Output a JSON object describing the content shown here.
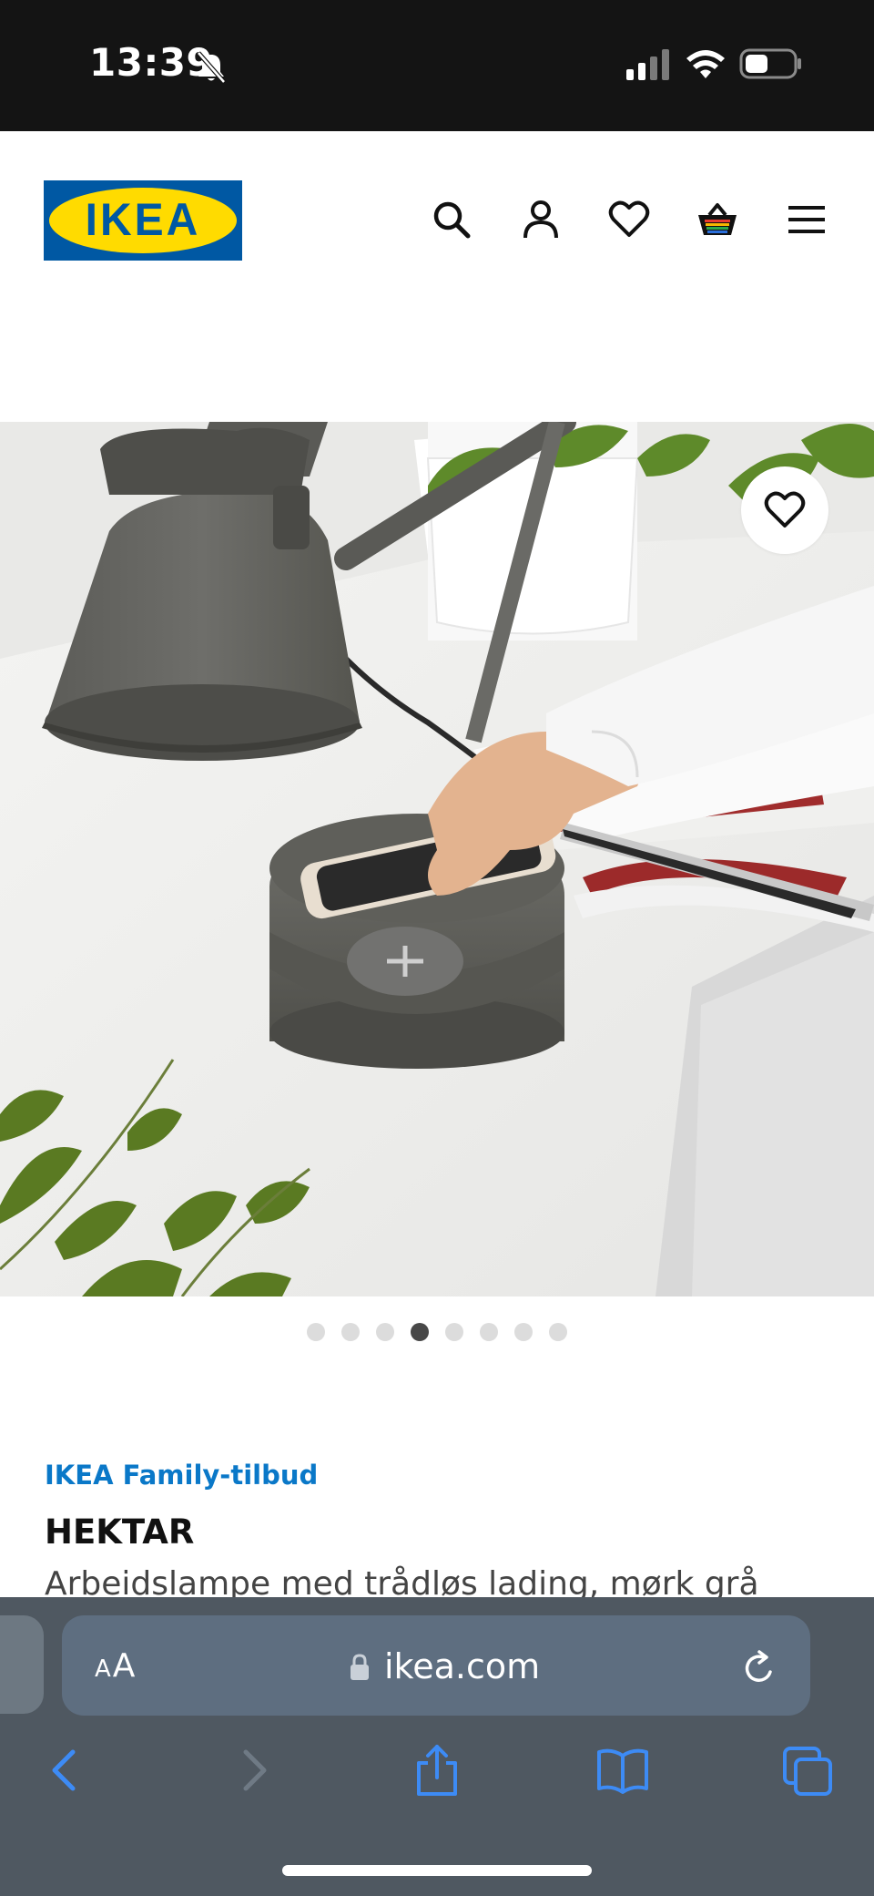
{
  "status_bar": {
    "time": "13:39",
    "icons": [
      "bell-slash-icon",
      "signal-icon",
      "wifi-icon",
      "battery-icon"
    ]
  },
  "header": {
    "logo_text": "IKEA",
    "icons": [
      "search-icon",
      "account-icon",
      "heart-icon",
      "cart-icon",
      "menu-icon"
    ]
  },
  "product_gallery": {
    "image_description_icon": "product-photo",
    "favorite_icon": "heart-icon",
    "dots_total": 8,
    "active_dot": 4
  },
  "product": {
    "offer_label": "IKEA Family-tilbud",
    "name": "HEKTAR",
    "description": "Arbeidslampe med trådløs lading, mørk grå"
  },
  "browser": {
    "text_size_label_small": "A",
    "text_size_label_large": "A",
    "url": "ikea.com",
    "toolbar_icons": [
      "back-icon",
      "forward-icon",
      "share-icon",
      "bookmarks-icon",
      "tabs-icon"
    ]
  },
  "colors": {
    "ikea_blue": "#0058a3",
    "ikea_yellow": "#ffdb00",
    "offer_blue": "#0a78c8",
    "safari_blue": "#3d8bf5",
    "status_bar_bg": "#141414",
    "browser_bar_bg": "#4f5861"
  }
}
